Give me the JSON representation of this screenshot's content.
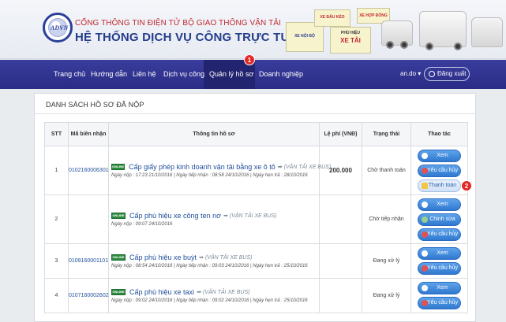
{
  "header": {
    "logo_text": "ADVN",
    "subtitle": "CỔNG THÔNG TIN ĐIỆN TỬ BỘ GIAO THÔNG VẬN TẢI",
    "title": "HỆ THỐNG DỊCH VỤ CÔNG TRỰC TUYẾN",
    "badges": [
      "XE ĐẦU KÉO",
      "XE HỢP ĐỒNG",
      "XE NỘI BỘ",
      "PHÙ HIỆU",
      "XE TẢI"
    ]
  },
  "nav": {
    "items": [
      "Trang chủ",
      "Hướng dẫn",
      "Liên hệ",
      "Dịch vụ công",
      "Quản lý hồ sơ",
      "Doanh nghiệp"
    ],
    "active": "Quản lý hồ sơ",
    "user": "an.do",
    "logout": "Đăng xuất"
  },
  "markers": [
    "1",
    "2"
  ],
  "panel": {
    "title": "DANH SÁCH HỒ SƠ ĐÃ NỘP"
  },
  "table": {
    "headers": [
      "STT",
      "Mã biên nhận",
      "Thông tin hồ sơ",
      "Lệ phí (VNĐ)",
      "Trạng thái",
      "Thao tác"
    ],
    "online_badge": "ONLINE",
    "rows": [
      {
        "stt": "1",
        "code": "0102160006301",
        "service": "Cấp giấy phép kinh doanh vận tải bằng xe ô tô",
        "type": "(VẬN TẢI XE BUS)",
        "dates": "Ngày nộp : 17:23 21/10/2016 | Ngày tiếp nhận : 08:58 24/10/2016 | Ngày hẹn trả : 28/10/2016",
        "fee": "200.000",
        "status": "Chờ thanh toán",
        "actions": [
          "Xem",
          "Yêu cầu hủy",
          "Thanh toán"
        ]
      },
      {
        "stt": "2",
        "code": "",
        "service": "Cấp phù hiệu xe công ten nơ",
        "type": "(VẬN TẢI XE BUS)",
        "dates": "Ngày nộp : 09:07 24/10/2016",
        "fee": "",
        "status": "Chờ tiếp nhận",
        "actions": [
          "Xem",
          "Chỉnh sửa",
          "Yêu cầu hủy"
        ]
      },
      {
        "stt": "3",
        "code": "0109160001101",
        "service": "Cấp phù hiệu xe buýt",
        "type": "(VẬN TẢI XE BUS)",
        "dates": "Ngày nộp : 08:54 24/10/2016 | Ngày tiếp nhận : 09:03 24/10/2016 | Ngày hẹn trả : 25/10/2016",
        "fee": "",
        "status": "Đang xử lý",
        "actions": [
          "Xem",
          "Yêu cầu hủy"
        ]
      },
      {
        "stt": "4",
        "code": "0107160002602",
        "service": "Cấp phù hiệu xe taxi",
        "type": "(VẬN TẢI XE BUS)",
        "dates": "Ngày nộp : 09:02 24/10/2016 | Ngày tiếp nhận : 09:02 24/10/2016 | Ngày hẹn trả : 25/10/2016",
        "fee": "",
        "status": "Đang xử lý",
        "actions": [
          "Xem",
          "Yêu cầu hủy"
        ]
      }
    ]
  }
}
